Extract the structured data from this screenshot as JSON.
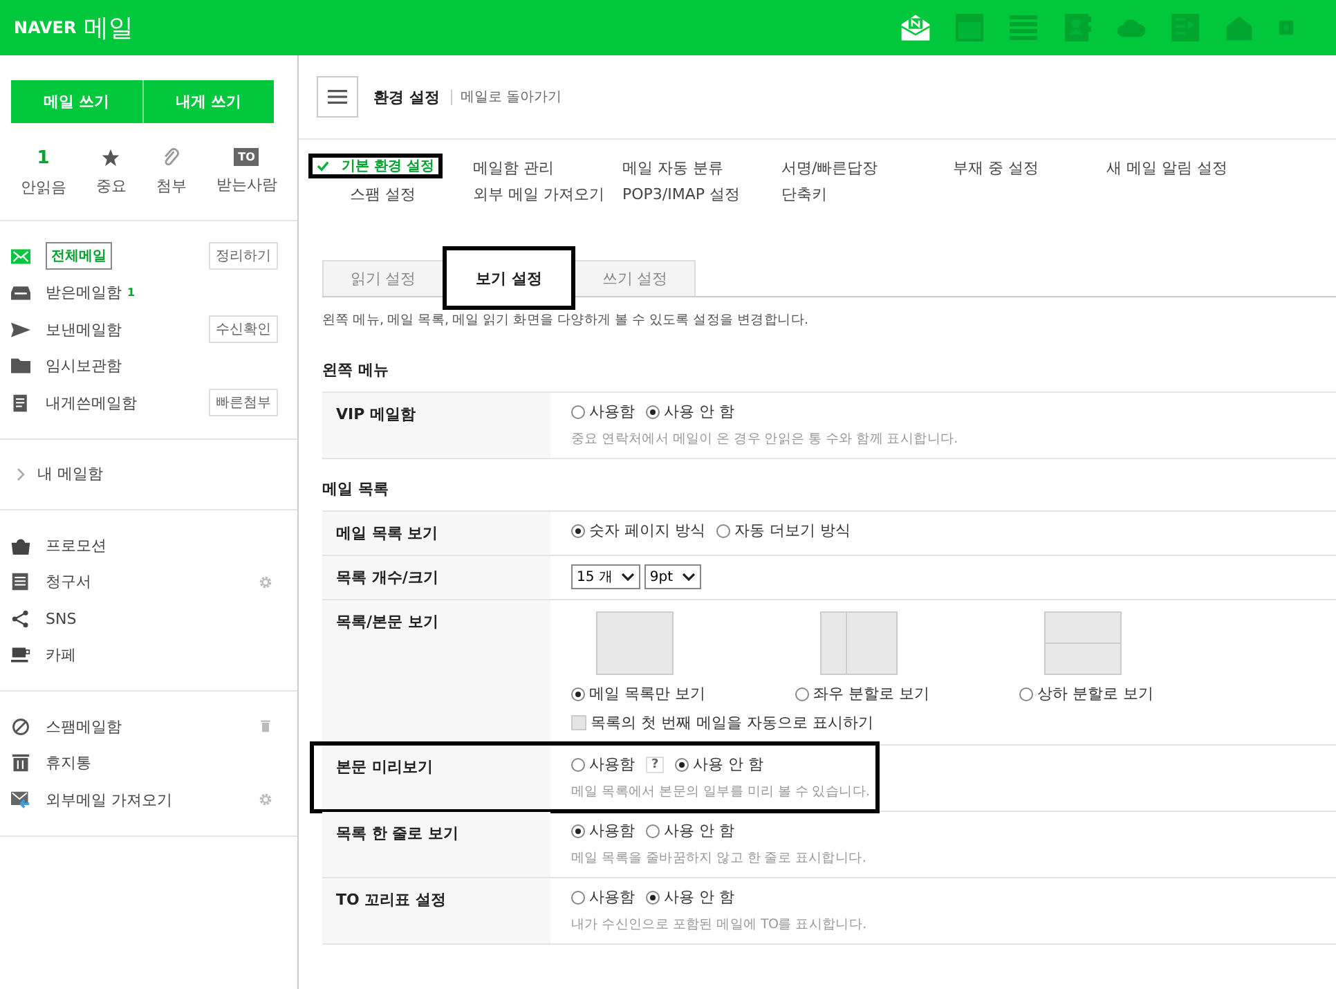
{
  "header": {
    "brand": "NAVER",
    "service": "메일",
    "apps": [
      {
        "kind": "mail",
        "active": true
      },
      {
        "kind": "calendar",
        "active": false
      },
      {
        "kind": "list",
        "active": false
      },
      {
        "kind": "contacts",
        "active": false
      },
      {
        "kind": "cloud",
        "active": false
      },
      {
        "kind": "memo",
        "active": false
      },
      {
        "kind": "home",
        "active": false
      },
      {
        "kind": "more",
        "active": false
      }
    ]
  },
  "sidebar": {
    "buttons": [
      "메일 쓰기",
      "내게 쓰기"
    ],
    "quick": [
      {
        "kind": "count",
        "value": "1",
        "label": "안읽음"
      },
      {
        "kind": "star",
        "label": "중요"
      },
      {
        "kind": "clip",
        "label": "첨부"
      },
      {
        "kind": "badge",
        "value": "TO",
        "label": "받는사람"
      }
    ],
    "folders": [
      {
        "label": "전체메일",
        "selected": true,
        "action": "정리하기"
      },
      {
        "label": "받은메일함",
        "selected": false,
        "count": "1"
      },
      {
        "label": "보낸메일함",
        "selected": false,
        "action": "수신확인"
      },
      {
        "label": "임시보관함",
        "selected": false
      },
      {
        "label": "내게쓴메일함",
        "selected": false,
        "action": "빠른첨부"
      }
    ],
    "my_box": {
      "label": "내 메일함",
      "expanded": false
    },
    "extras": [
      {
        "label": "프로모션"
      },
      {
        "label": "청구서"
      },
      {
        "label": "SNS"
      },
      {
        "label": "카페"
      }
    ],
    "others": [
      {
        "label": "스팸메일함"
      },
      {
        "label": "휴지통"
      },
      {
        "label": "외부메일 가져오기"
      }
    ]
  },
  "main": {
    "title": "환경 설정",
    "back_link": "메일로 돌아가기",
    "nav": [
      [
        {
          "label": "기본 환경 설정",
          "selected": true,
          "marked": true
        },
        {
          "label": "메일함 관리",
          "selected": false,
          "marked": false
        },
        {
          "label": "메일 자동 분류",
          "selected": false,
          "marked": false
        },
        {
          "label": "서명/빠른답장",
          "selected": false,
          "marked": false
        },
        {
          "label": "부재 중 설정",
          "selected": false,
          "marked": false
        },
        {
          "label": "새 메일 알림 설정",
          "selected": false,
          "marked": false
        }
      ],
      [
        {
          "label": "스팸 설정",
          "selected": false,
          "marked": false
        },
        {
          "label": "외부 메일 가져오기",
          "selected": false,
          "marked": false
        },
        {
          "label": "POP3/IMAP 설정",
          "selected": false,
          "marked": false
        },
        {
          "label": "단축키",
          "selected": false,
          "marked": false
        }
      ]
    ],
    "tabs": [
      {
        "label": "읽기 설정",
        "selected": false,
        "marked": false
      },
      {
        "label": "보기 설정",
        "selected": true,
        "marked": true
      },
      {
        "label": "쓰기 설정",
        "selected": false,
        "marked": false
      }
    ],
    "description": "왼쪽 메뉴, 메일 목록, 메일 읽기 화면을 다양하게 볼 수 있도록 설정을 변경합니다.",
    "sections": [
      {
        "title": "왼쪽 메뉴",
        "rows": [
          {
            "kind": "radio",
            "label": "VIP 메일함",
            "marked": false,
            "options": [
              {
                "label": "사용함",
                "selected": false
              },
              {
                "label": "사용 안 함",
                "selected": true
              }
            ],
            "note": "중요 연락처에서 메일이 온 경우 안읽은 통 수와 함께 표시합니다."
          }
        ]
      },
      {
        "title": "메일 목록",
        "rows": [
          {
            "kind": "radio",
            "label": "메일 목록 보기",
            "marked": false,
            "options": [
              {
                "label": "숫자 페이지 방식",
                "selected": true
              },
              {
                "label": "자동 더보기 방식",
                "selected": false
              }
            ]
          },
          {
            "kind": "selects",
            "label": "목록 개수/크기",
            "marked": false,
            "selects": [
              "15 개",
              "9pt"
            ]
          },
          {
            "kind": "layout",
            "label": "목록/본문 보기",
            "marked": false,
            "layouts": [
              {
                "kind": "single",
                "label": "메일 목록만 보기",
                "selected": true
              },
              {
                "kind": "vertical",
                "label": "좌우 분할로 보기",
                "selected": false
              },
              {
                "kind": "horizontal",
                "label": "상하 분할로 보기",
                "selected": false
              }
            ],
            "checkbox": {
              "label": "목록의 첫 번째 메일을 자동으로 표시하기",
              "checked": false
            }
          },
          {
            "kind": "radio",
            "label": "본문 미리보기",
            "marked": true,
            "help": "?",
            "options": [
              {
                "label": "사용함",
                "selected": false
              },
              {
                "label": "사용 안 함",
                "selected": true
              }
            ],
            "note": "메일 목록에서 본문의 일부를 미리 볼 수 있습니다."
          },
          {
            "kind": "radio",
            "label": "목록 한 줄로 보기",
            "marked": false,
            "options": [
              {
                "label": "사용함",
                "selected": true
              },
              {
                "label": "사용 안 함",
                "selected": false
              }
            ],
            "note": "메일 목록을 줄바꿈하지 않고 한 줄로 표시합니다."
          },
          {
            "kind": "radio",
            "label": "TO 꼬리표 설정",
            "marked": false,
            "options": [
              {
                "label": "사용함",
                "selected": false
              },
              {
                "label": "사용 안 함",
                "selected": true
              }
            ],
            "note": "내가 수신인으로 포함된 메일에 TO를 표시합니다."
          }
        ]
      }
    ]
  }
}
